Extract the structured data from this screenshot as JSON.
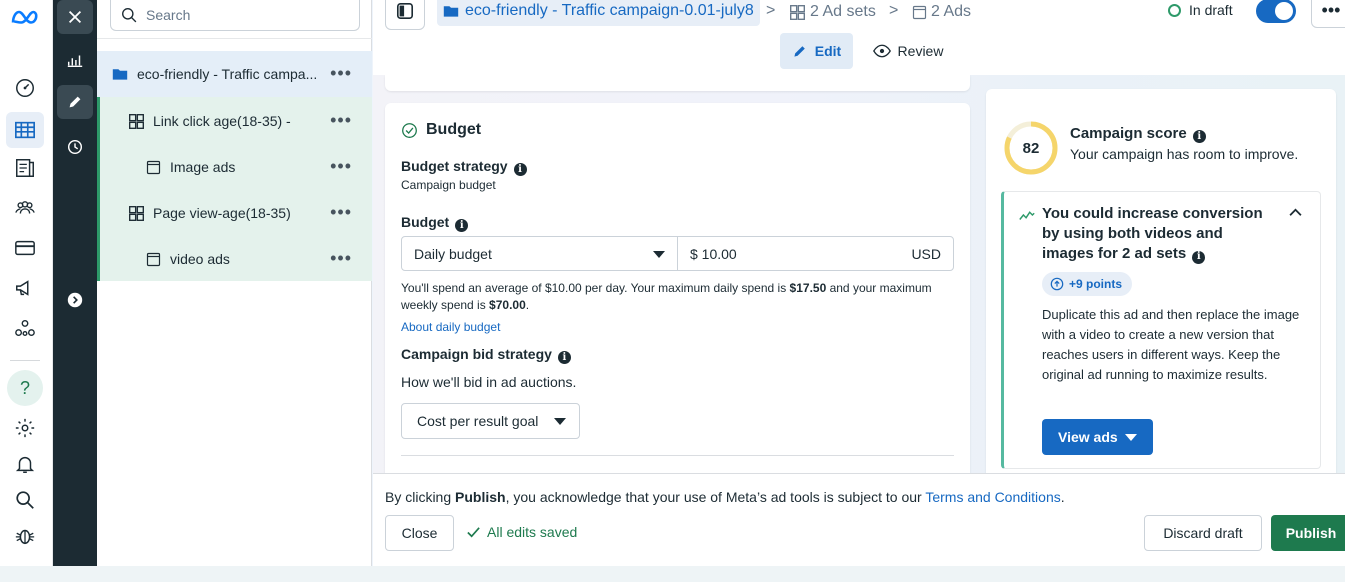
{
  "colors": {
    "accent_blue": "#1769c2",
    "publish_green": "#1e7a4e",
    "dark_strip": "#1c2b33",
    "tree_selected": "#e4eef8",
    "tree_group": "#e4f2ec",
    "score_ring": "#f5d56b"
  },
  "rail": {
    "icons": [
      "meta-logo-icon",
      "dashboard-icon",
      "ads-manager-icon",
      "pages-icon",
      "audiences-icon",
      "billing-icon",
      "campaign-megaphone-icon",
      "accounts-network-icon",
      "help-icon",
      "settings-icon",
      "notifications-icon",
      "search-icon",
      "bug-report-icon"
    ]
  },
  "dark_strip": {
    "icons": [
      "close-icon",
      "reports-icon",
      "edit-icon",
      "history-icon",
      "expand-icon"
    ]
  },
  "tree": {
    "search_placeholder": "Search",
    "campaign": "eco-friendly - Traffic campa...",
    "items": [
      {
        "label": "Link click age(18-35) -",
        "type": "ad-set"
      },
      {
        "label": "Image ads",
        "type": "ad"
      },
      {
        "label": "Page view-age(18-35)",
        "type": "ad-set"
      },
      {
        "label": "video ads",
        "type": "ad"
      }
    ],
    "more": "•••"
  },
  "header": {
    "campaign_name": "eco-friendly - Traffic campaign-0.01-july8",
    "adsets": "2 Ad sets",
    "ads": "2 Ads",
    "separator": ">",
    "status": "In draft",
    "toggle_on": true,
    "more": "•••",
    "tabs": {
      "edit": "Edit",
      "review": "Review"
    }
  },
  "budget": {
    "title": "Budget",
    "strategy_label": "Budget strategy",
    "strategy_value": "Campaign budget",
    "budget_label": "Budget",
    "budget_type": "Daily budget",
    "amount": "$ 10.00",
    "currency": "USD",
    "note_prefix": "You'll spend an average of $10.00 per day. Your maximum daily spend is ",
    "note_max_daily": "$17.50",
    "note_mid": " and your maximum weekly spend is ",
    "note_max_weekly": "$70.00",
    "note_end": ".",
    "about_link": "About daily budget",
    "bid_label": "Campaign bid strategy",
    "bid_desc": "How we'll bid in ad auctions.",
    "bid_value": "Cost per result goal"
  },
  "score": {
    "value": "82",
    "value_fraction": 0.82,
    "title": "Campaign score",
    "subtitle": "Your campaign has room to improve.",
    "rec_title": "You could increase conversion by using both videos and images for 2 ad sets",
    "rec_points": "+9 points",
    "rec_desc": "Duplicate this ad and then replace the image with a video to create a new version that reaches users in different ways. Keep the original ad running to maximize results.",
    "rec_button": "View ads"
  },
  "footer": {
    "terms_prefix": "By clicking ",
    "terms_bold": "Publish",
    "terms_mid": ", you acknowledge that your use of Meta’s ad tools is subject to our ",
    "terms_link": "Terms and Conditions",
    "terms_end": ".",
    "close": "Close",
    "saved": "All edits saved",
    "discard": "Discard draft",
    "publish": "Publish"
  }
}
